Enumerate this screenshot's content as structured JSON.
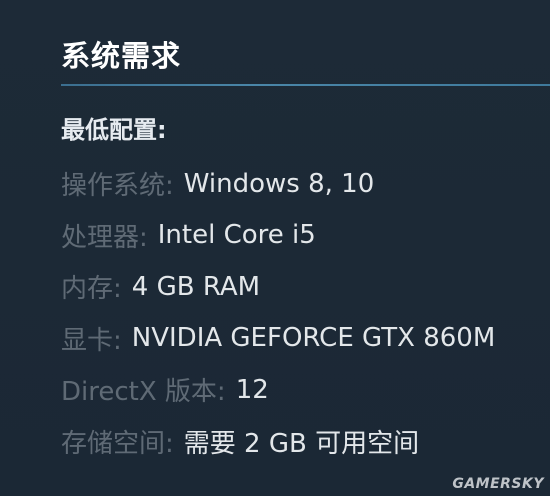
{
  "section": {
    "title": "系统需求"
  },
  "requirements": {
    "heading": "最低配置:",
    "rows": [
      {
        "label": "操作系统:",
        "value": "Windows 8, 10"
      },
      {
        "label": "处理器:",
        "value": "Intel Core i5"
      },
      {
        "label": "内存:",
        "value": "4 GB RAM"
      },
      {
        "label": "显卡:",
        "value": "NVIDIA GEFORCE GTX 860M"
      },
      {
        "label": "DirectX 版本:",
        "value": "12"
      },
      {
        "label": "存储空间:",
        "value": "需要 2 GB 可用空间"
      }
    ]
  },
  "watermark": "GAMERSKY",
  "colors": {
    "background": "#1b2838",
    "title": "#ffffff",
    "label": "#5f6a75",
    "value": "#e3e7ea",
    "rule": "#4a86a8"
  }
}
